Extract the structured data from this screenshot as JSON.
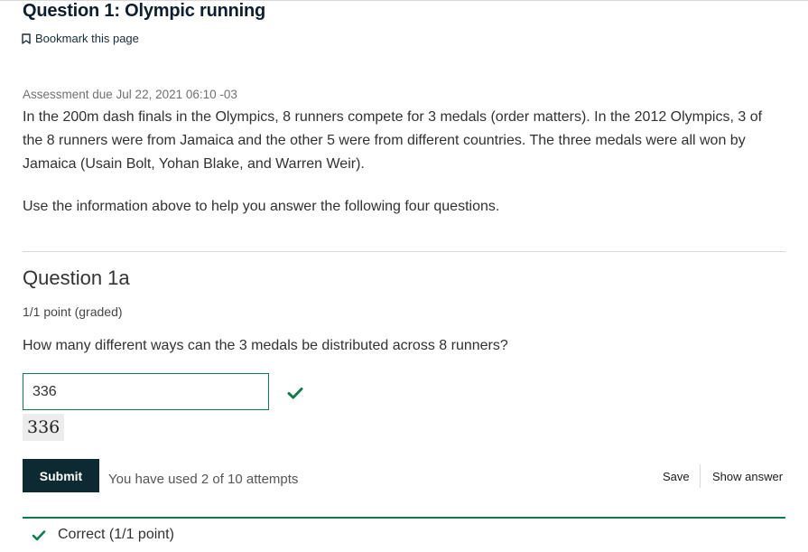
{
  "page": {
    "title": "Question 1: Olympic running",
    "bookmark_label": "Bookmark this page",
    "due_text": "Assessment due Jul 22, 2021 06:10 -03",
    "intro_paragraph": "In the 200m dash finals in the Olympics, 8 runners compete for 3 medals (order matters). In the 2012 Olympics, 3 of the 8 runners were from Jamaica and the other 5 were from different countries. The three medals were all won by Jamaica (Usain Bolt, Yohan Blake, and Warren Weir).",
    "instruction": "Use the information above to help you answer the following four questions."
  },
  "question": {
    "heading": "Question 1a",
    "points": "1/1 point (graded)",
    "prompt": "How many different ways can the 3 medals be distributed across 8 runners?",
    "answer_value": "336",
    "answer_preview": "336",
    "answer_status": "correct"
  },
  "actions": {
    "submit_label": "Submit",
    "attempts_text": "You have used 2 of 10 attempts",
    "save_label": "Save",
    "show_answer_label": "Show answer"
  },
  "status": {
    "text": "Correct (1/1 point)"
  },
  "icons": {
    "bookmark": "bookmark-icon",
    "correct": "checkmark-icon"
  },
  "colors": {
    "accent": "#0d7d4d",
    "submit_bg": "#0d2a33",
    "title": "#0d1f2e"
  }
}
